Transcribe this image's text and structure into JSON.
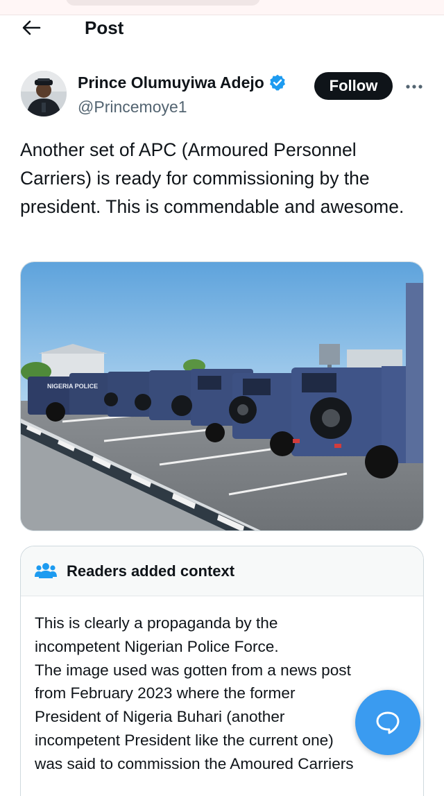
{
  "status_strip": {},
  "header": {
    "title": "Post",
    "back_icon": "arrow-left-icon"
  },
  "author": {
    "name": "Prince Olumuyiwa Adejo",
    "handle": "@Princemoye1",
    "verified_icon": "verified-badge-icon",
    "verified_color": "#1d9bf0",
    "follow_label": "Follow",
    "more_icon": "more-horizontal-icon"
  },
  "post": {
    "text": "Another set of APC (Armoured Personnel Carriers) is ready for commissioning by the president. This is commendable and awesome.",
    "image_text": "NIGERIA POLICE"
  },
  "context": {
    "title": "Readers added context",
    "icon": "people-icon",
    "accent_color": "#1d9bf0",
    "lines": [
      "This is clearly a propaganda by the",
      "incompetent Nigerian Police Force.",
      "The image used was gotten from a news post",
      "from February 2023 where the former",
      "President of Nigeria Buhari (another",
      "incompetent President like the current one)",
      "was said to commission the Amoured Carriers"
    ]
  },
  "fab": {
    "icon": "chat-bubble-icon",
    "color": "#3a9bf0"
  }
}
